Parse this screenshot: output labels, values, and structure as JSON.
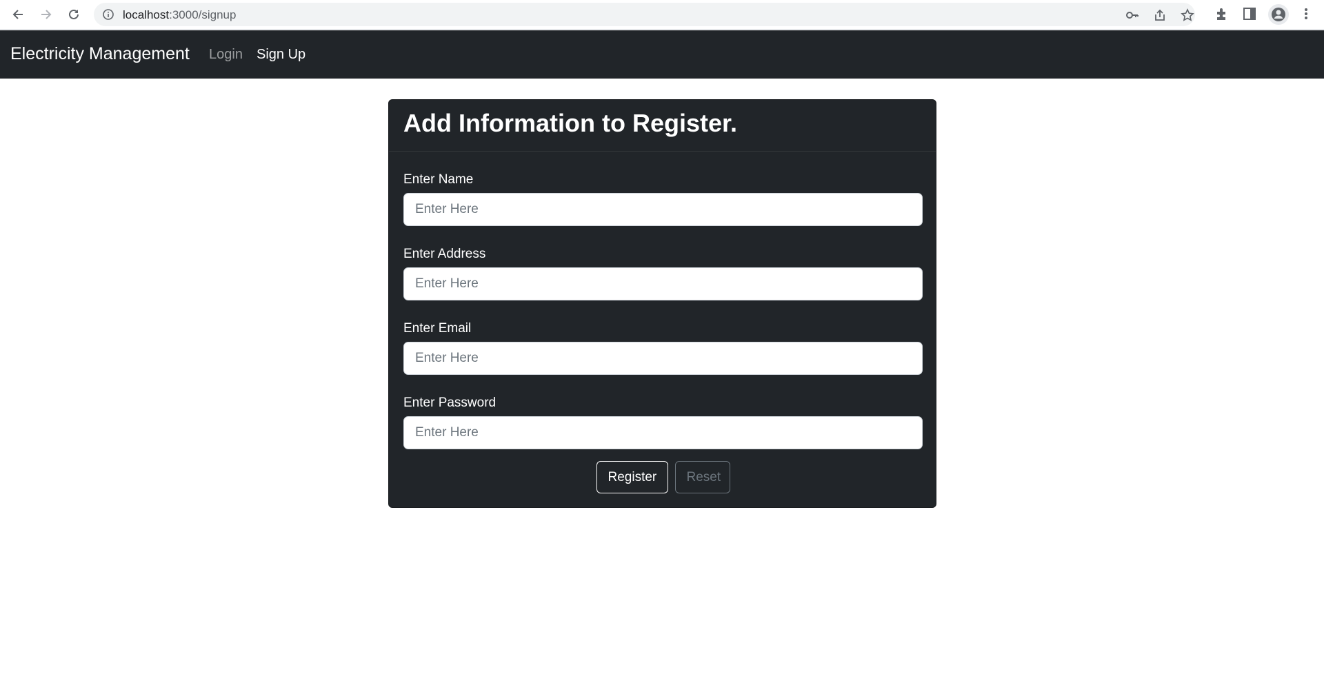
{
  "browser": {
    "url_host": "localhost",
    "url_path": ":3000/signup",
    "icons": [
      "back-icon",
      "forward-icon",
      "reload-icon",
      "info-icon",
      "key-icon",
      "share-icon",
      "star-icon",
      "extensions-icon",
      "side-panel-icon",
      "profile-icon",
      "menu-icon"
    ]
  },
  "navbar": {
    "brand": "Electricity Management",
    "links": [
      {
        "label": "Login",
        "active": false
      },
      {
        "label": "Sign Up",
        "active": true
      }
    ],
    "background": "#212529"
  },
  "form": {
    "title": "Add Information to Register.",
    "fields": [
      {
        "label": "Enter Name",
        "placeholder": "Enter Here",
        "value": ""
      },
      {
        "label": "Enter Address",
        "placeholder": "Enter Here",
        "value": ""
      },
      {
        "label": "Enter Email",
        "placeholder": "Enter Here",
        "value": ""
      },
      {
        "label": "Enter Password",
        "placeholder": "Enter Here",
        "value": ""
      }
    ],
    "buttons": {
      "register": "Register",
      "reset": "Reset"
    }
  }
}
